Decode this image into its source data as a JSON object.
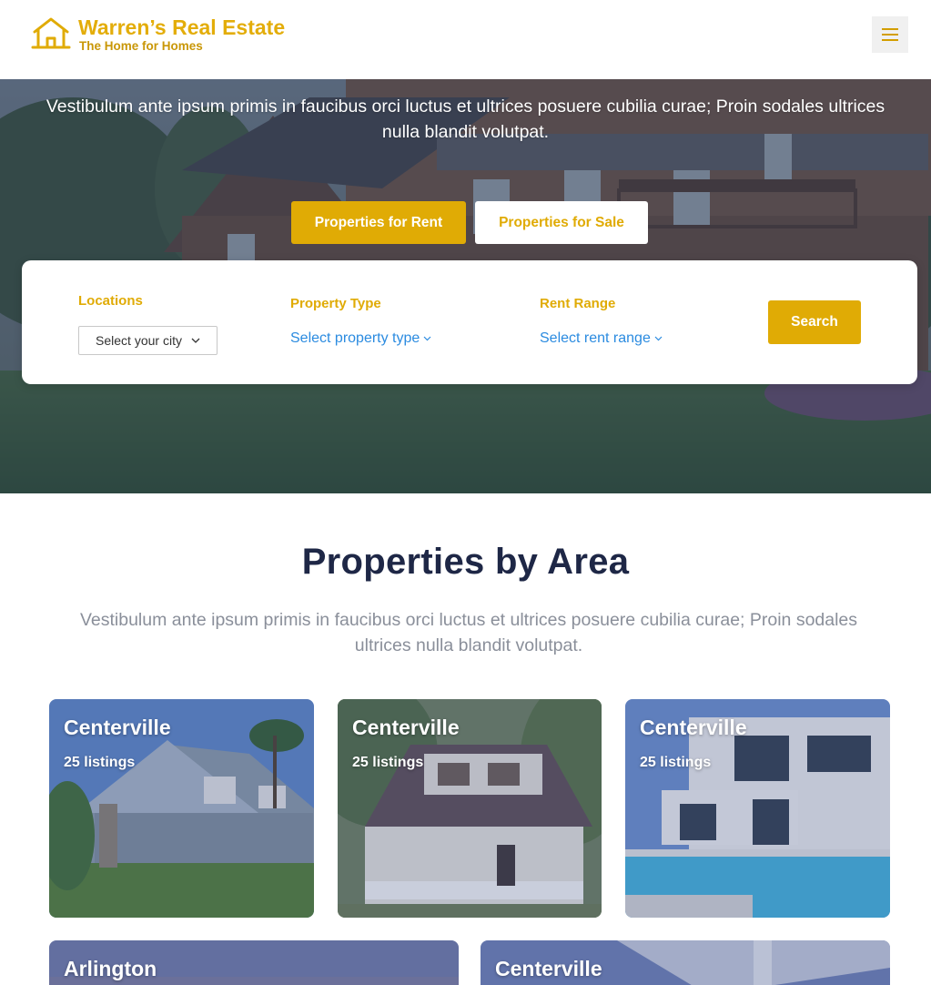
{
  "brand": {
    "name": "Warren’s Real Estate",
    "tagline": "The Home for Homes",
    "accent_color": "#e0ab05"
  },
  "header": {
    "menu_icon": "hamburger-menu-icon"
  },
  "hero": {
    "text": "Vestibulum ante ipsum primis in faucibus orci luctus et ultrices posuere cubilia curae; Proin sodales ultrices nulla blandit volutpat.",
    "tabs": [
      {
        "label": "Properties for Rent",
        "active": true
      },
      {
        "label": "Properties for Sale",
        "active": false
      }
    ]
  },
  "search": {
    "locations_label": "Locations",
    "locations_value": "Select your city",
    "type_label": "Property Type",
    "type_value": "Select property type",
    "range_label": "Rent Range",
    "range_value": "Select rent range",
    "button_label": "Search"
  },
  "areas": {
    "title": "Properties by Area",
    "subtitle": "Vestibulum ante ipsum primis in faucibus orci luctus et ultrices posuere cubilia curae; Proin sodales ultrices nulla blandit volutpat.",
    "cards": [
      {
        "name": "Centerville",
        "count": "25 listings"
      },
      {
        "name": "Centerville",
        "count": "25 listings"
      },
      {
        "name": "Centerville",
        "count": "25 listings"
      },
      {
        "name": "Arlington",
        "count": ""
      },
      {
        "name": "Centerville",
        "count": ""
      }
    ]
  }
}
